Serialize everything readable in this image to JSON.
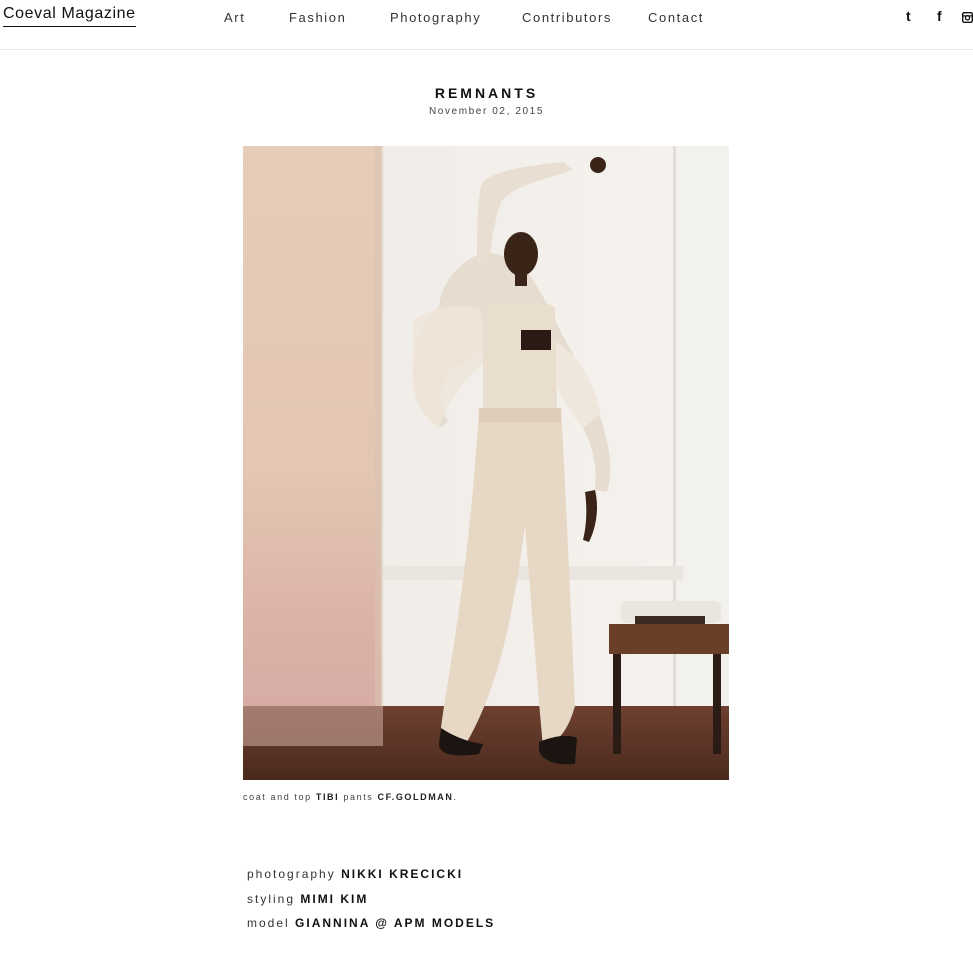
{
  "site": {
    "logo": "Coeval Magazine",
    "nav": [
      "Art",
      "Fashion",
      "Photography",
      "Contributors",
      "Contact"
    ],
    "social": [
      {
        "icon": "tumblr-icon",
        "glyph": "t"
      },
      {
        "icon": "facebook-icon",
        "glyph": "f"
      },
      {
        "icon": "instagram-icon",
        "glyph": ""
      }
    ]
  },
  "article": {
    "title": "REMNANTS",
    "date": "November 02, 2015",
    "caption": {
      "prefix": "coat and top",
      "brand1": "TIBI",
      "mid": "pants",
      "brand2": "CF.GOLDMAN",
      "suffix": "."
    },
    "credits": [
      {
        "role": "photography",
        "name": "NIKKI KRECICKI"
      },
      {
        "role": "styling",
        "name": "MIMI KIM"
      },
      {
        "role": "model",
        "name": "GIANNINA @ APM MODELS"
      }
    ]
  },
  "colors": {
    "wall": "#f3efea",
    "rug_pink": "#e2b9ad",
    "outfit": "#e8dccd",
    "floor": "#5a3524"
  }
}
